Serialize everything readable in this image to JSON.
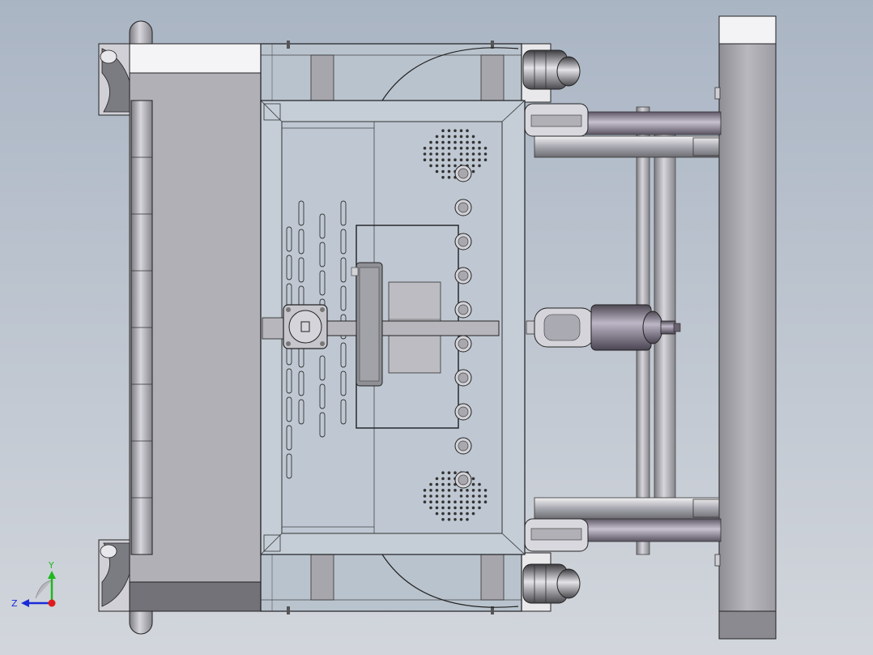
{
  "viewport": {
    "background_top": "#aab5c4",
    "background_bottom": "#d2d6dc"
  },
  "triad": {
    "y_label": "Y",
    "z_label": "Z",
    "y_color": "#1fb81f",
    "z_color": "#1a2bd8",
    "origin_color": "#e01b1b"
  },
  "colors": {
    "frame_light": "#f4f4f6",
    "frame_mid": "#b4b4ba",
    "frame_dark": "#6e6e74",
    "glass": "#b9c3cd",
    "edge": "#1e1e22",
    "rod_purple": "#8a8294"
  }
}
